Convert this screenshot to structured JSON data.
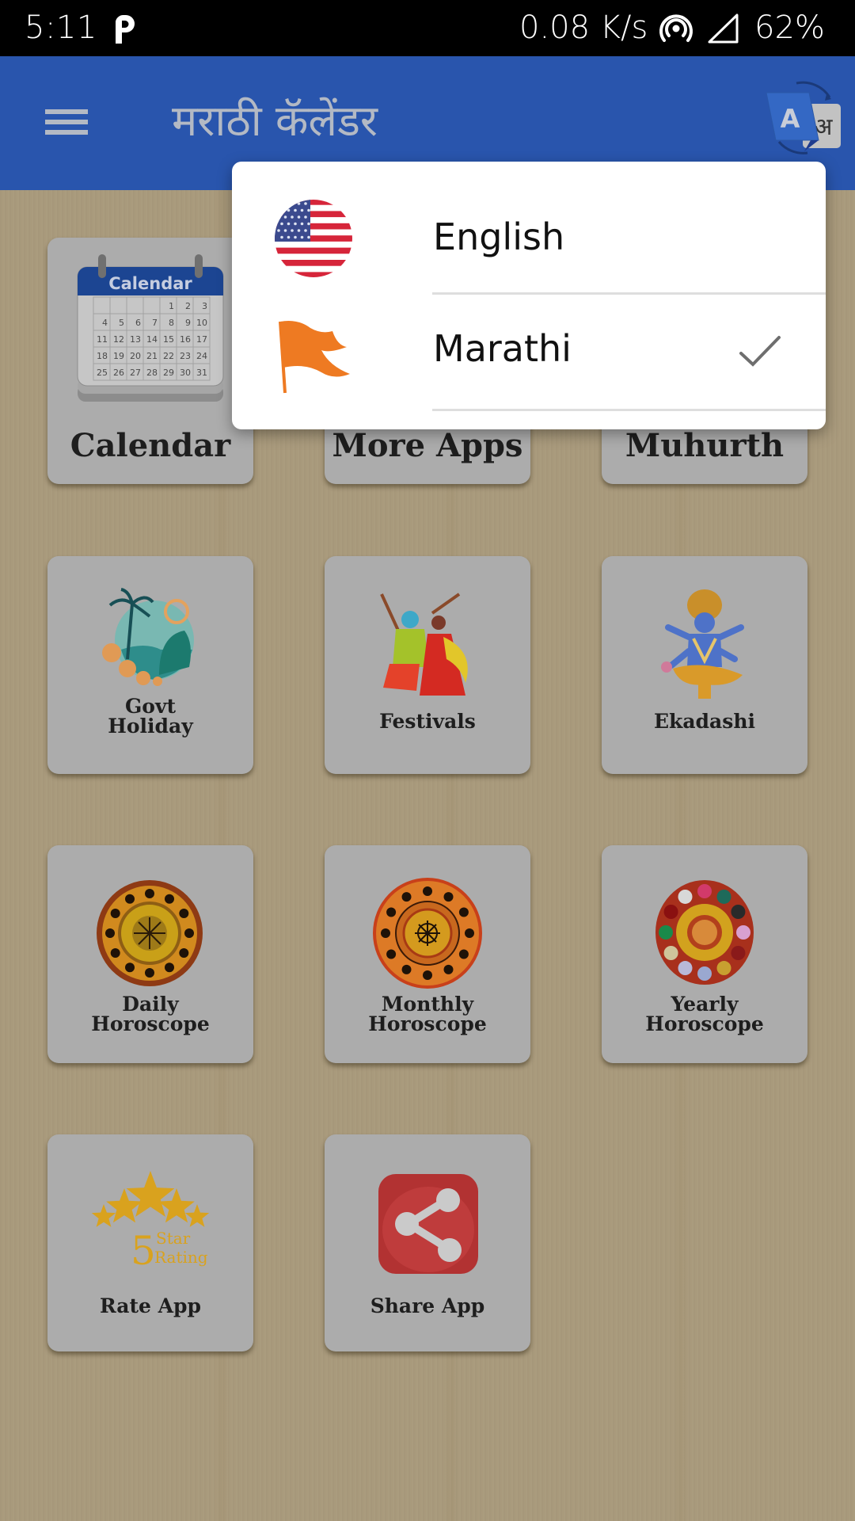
{
  "status_bar": {
    "time": "5:11",
    "notification_icon": "p-app-icon",
    "net_speed": "0.08 K/s",
    "hotspot_icon": "hotspot-icon",
    "signal_icon": "signal-icon",
    "battery": "62%"
  },
  "app_bar": {
    "menu_icon": "hamburger-menu-icon",
    "title": "मराठी कॅलेंडर",
    "translate_icon": "translate-icon",
    "translate_glyph_latin": "A",
    "translate_glyph_devanagari": "अ",
    "color": "#2955ad"
  },
  "calendar_icon": {
    "header": "Calendar",
    "days": [
      "",
      "",
      "",
      "",
      "1",
      "2",
      "3",
      "4",
      "5",
      "6",
      "7",
      "8",
      "9",
      "10",
      "11",
      "12",
      "13",
      "14",
      "15",
      "16",
      "17",
      "18",
      "19",
      "20",
      "21",
      "22",
      "23",
      "24",
      "25",
      "26",
      "27",
      "28",
      "29",
      "30",
      "31"
    ]
  },
  "grid": {
    "tiles": [
      {
        "label": "Calendar",
        "icon": "calendar-icon"
      },
      {
        "label": "More Apps",
        "icon": "more-apps-icon"
      },
      {
        "label": "Muhurth",
        "icon": "muhurth-icon"
      },
      {
        "label_lines": [
          "Govt",
          "Holiday"
        ],
        "icon": "beach-holiday-icon"
      },
      {
        "label": "Festivals",
        "icon": "dancers-festival-icon"
      },
      {
        "label": "Ekadashi",
        "icon": "vishnu-deity-icon"
      },
      {
        "label_lines": [
          "Daily",
          "Horoscope"
        ],
        "icon": "zodiac-wheel-icon"
      },
      {
        "label_lines": [
          "Monthly",
          "Horoscope"
        ],
        "icon": "zodiac-wheel-orange-icon"
      },
      {
        "label_lines": [
          "Yearly",
          "Horoscope"
        ],
        "icon": "navagraha-wheel-icon"
      },
      {
        "label": "Rate App",
        "icon": "five-star-rating-icon",
        "rating_text": [
          "5",
          "Star",
          "Rating"
        ]
      },
      {
        "label": "Share App",
        "icon": "share-icon"
      }
    ]
  },
  "language_menu": {
    "items": [
      {
        "label": "English",
        "icon": "us-flag-icon",
        "selected": false
      },
      {
        "label": "Marathi",
        "icon": "saffron-flag-icon",
        "selected": true
      }
    ],
    "check_icon": "checkmark-icon"
  }
}
